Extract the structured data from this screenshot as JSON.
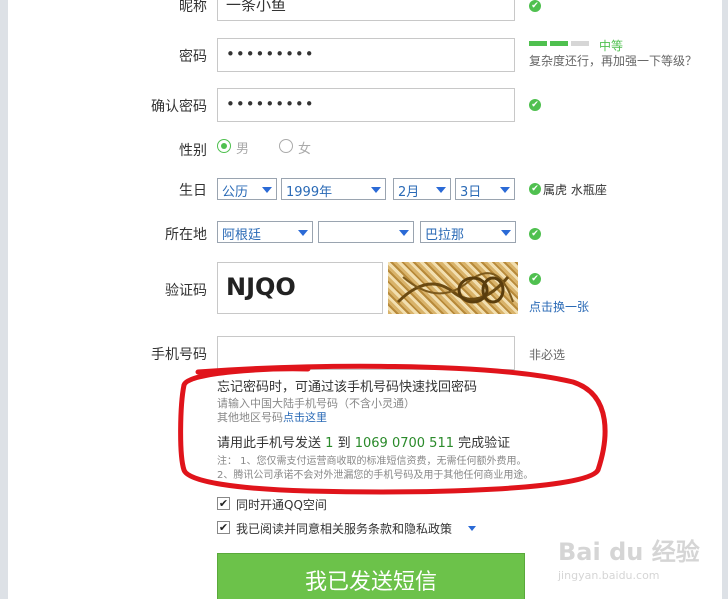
{
  "nickname": {
    "label": "昵称",
    "value": "一条小鱼"
  },
  "password": {
    "label": "密码",
    "value": "•••••••••",
    "strength_label": "中等",
    "strength_hint": "复杂度还行，再加强一下等级？"
  },
  "confirm_password": {
    "label": "确认密码",
    "value": "•••••••••"
  },
  "gender": {
    "label": "性别",
    "male": "男",
    "female": "女",
    "selected": "male"
  },
  "birthday": {
    "label": "生日",
    "calendar": "公历",
    "year": "1999年",
    "month": "2月",
    "day": "3日",
    "zodiac": "属虎 水瓶座"
  },
  "location": {
    "label": "所在地",
    "country": "阿根廷",
    "province": "",
    "city": "巴拉那"
  },
  "captcha": {
    "label": "验证码",
    "value": "NJQO",
    "refresh_link": "点击换一张"
  },
  "phone": {
    "label": "手机号码",
    "value": "",
    "optional_hint": "非必选"
  },
  "info": {
    "line1": "忘记密码时，可通过该手机号码快速找回密码",
    "line2": "请输入中国大陆手机号码（不含小灵通）",
    "line3_prefix": "其他地区号码",
    "line3_link": "点击这里",
    "verify_prefix": "请用此手机号发送",
    "verify_code": "1",
    "verify_mid": "到",
    "verify_number": "1069 0700 511",
    "verify_suffix": "完成验证",
    "note1": "注： 1、您仅需支付运营商收取的标准短信资费，无需任何额外费用。",
    "note2": "2、腾讯公司承诺不会对外泄漏您的手机号码及用于其他任何商业用途。"
  },
  "options": {
    "qzone": "同时开通QQ空间",
    "agreement": "我已阅读并同意相关服务条款和隐私政策"
  },
  "submit_label": "我已发送短信",
  "watermark": {
    "brand": "Bai du 经验",
    "url": "jingyan.baidu.com"
  },
  "colors": {
    "accent": "#4fc04f",
    "link": "#2a6ab6",
    "button": "#6cc24a",
    "annotation": "#e0141b"
  }
}
